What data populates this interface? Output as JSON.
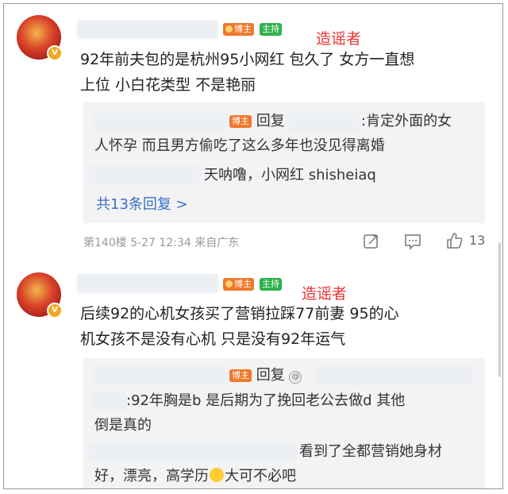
{
  "comments": [
    {
      "badge_blogger": "博主",
      "badge_host": "主持",
      "annotation": "造谣者",
      "text_line1": "92年前夫包的是杭州95小网红 包久了 女方一直想",
      "text_line2": "上位 小白花类型 不是艳丽",
      "replies": {
        "r1_tag": "博主",
        "r1_reply": "回复",
        "r1_text_a": ":肯定外面的女",
        "r1_text_b": "人怀孕 而且男方偷吃了这么多年也没见得离婚",
        "r2_text": "天呐噜，小网红 shisheiaq",
        "more": "共13条回复 >"
      },
      "floor": "第140楼",
      "date": "5-27 12:34",
      "location": "来自广东",
      "likes": "13"
    },
    {
      "badge_blogger": "博主",
      "badge_host": "主持",
      "annotation": "造谣者",
      "text_line1": "后续92的心机女孩买了营销拉踩77前妻 95的心",
      "text_line2": "机女孩不是没有心机 只是没有92年运气",
      "replies": {
        "r1_tag": "博主",
        "r1_reply": "回复",
        "r1_text_a": ":92年胸是b 是后期为了挽回老公去做d 其他",
        "r1_text_b": "倒是真的",
        "r2_text_a": "看到了全都营销她身材",
        "r2_text_b": "好，漂亮，高学历",
        "r2_text_c": "大可不必吧"
      }
    }
  ],
  "icons": {
    "share": "share-icon",
    "comment": "comment-icon",
    "like": "thumbs-up-icon",
    "verified": "verified-v-icon"
  },
  "colors": {
    "annotation": "#ee3333",
    "link": "#3a6fc4",
    "blogger_badge": "#f0782b",
    "host_badge": "#2fb14b",
    "reply_bg": "#f3f3f3"
  }
}
